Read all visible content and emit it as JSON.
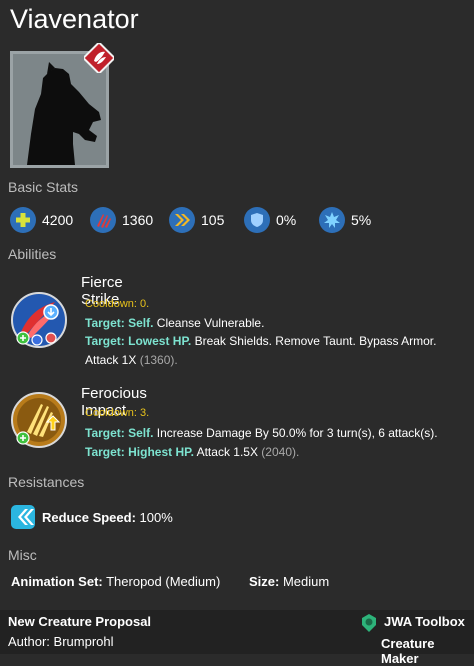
{
  "creature": {
    "name": "Viavenator"
  },
  "sections": {
    "basic_stats": "Basic Stats",
    "abilities": "Abilities",
    "resistances": "Resistances",
    "misc": "Misc"
  },
  "stats": [
    {
      "name": "health",
      "value": "4200",
      "icon": "health-plus-icon",
      "color": "#2d6fb8"
    },
    {
      "name": "damage",
      "value": "1360",
      "icon": "damage-claw-icon",
      "color": "#2d6fb8"
    },
    {
      "name": "speed",
      "value": "105",
      "icon": "speed-chevrons-icon",
      "color": "#2d6fb8"
    },
    {
      "name": "armor",
      "value": "0%",
      "icon": "armor-shield-icon",
      "color": "#2d6fb8"
    },
    {
      "name": "crit",
      "value": "5%",
      "icon": "crit-burst-icon",
      "color": "#2d6fb8"
    }
  ],
  "abilities": [
    {
      "name": "Fierce Strike",
      "cooldown": "Cooldown: 0.",
      "line1_target": "Target: Self.",
      "line1_text": " Cleanse Vulnerable.",
      "line2_target": "Target: Lowest HP.",
      "line2_text": " Break Shields. Remove Taunt. Bypass Armor.",
      "line3_text": "Attack 1X ",
      "line3_gray": "(1360)."
    },
    {
      "name": "Ferocious Impact",
      "cooldown": "Cooldown: 3.",
      "line1_target": "Target: Self.",
      "line1_text": " Increase Damage By 50.0% for 3 turn(s), 6 attack(s).",
      "line2_target": "Target: Highest HP.",
      "line2_text": " Attack 1.5X ",
      "line2_gray": "(2040)."
    }
  ],
  "resistances": [
    {
      "label": "Reduce Speed:",
      "value": " 100%",
      "icon": "reduce-speed-icon"
    }
  ],
  "misc": {
    "animation_label": "Animation Set:",
    "animation_value": " Theropod (Medium)",
    "size_label": "Size:",
    "size_value": " Medium"
  },
  "footer": {
    "proposal": "New Creature Proposal",
    "author": "Author:  Brumprohl",
    "brand": "JWA Toolbox",
    "tool": "Creature Maker"
  },
  "colors": {
    "background": "#2b2b2b",
    "cooldown": "#e8c21b",
    "target": "#7de3d0",
    "rarity": "#c0202a"
  }
}
